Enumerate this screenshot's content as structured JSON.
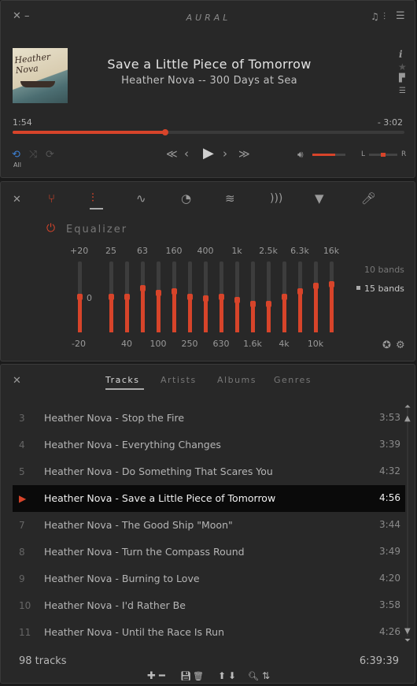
{
  "app": {
    "title": "AURAL"
  },
  "player": {
    "track_title": "Save a Little Piece of Tomorrow",
    "track_subtitle": "Heather Nova -- 300 Days at Sea",
    "album_art_text": "Heather Nova",
    "time_elapsed": "1:54",
    "time_remaining": "- 3:02",
    "progress": 0.39,
    "volume": 0.7,
    "balance": 0.5,
    "repeat_label": "All",
    "balance_left": "L",
    "balance_right": "R",
    "icons": {
      "close": "close-icon",
      "minimize": "minimize-icon",
      "playlist": "playlist-icon",
      "equalizer": "equalizer-toggle-icon",
      "menu": "menu-icon",
      "info": "info-icon",
      "star": "star-icon",
      "bookmark": "bookmark-icon",
      "lyrics": "lyrics-icon",
      "repeat": "repeat-icon",
      "shuffle": "shuffle-icon",
      "loop": "loop-icon",
      "rewind": "rewind-icon",
      "previous": "previous-icon",
      "play": "play-icon",
      "next": "next-icon",
      "fast_forward": "fast-forward-icon",
      "volume": "volume-icon"
    }
  },
  "effects": {
    "section_title": "Equalizer",
    "tabs": [
      "master",
      "equalizer",
      "pitch",
      "time",
      "reverb",
      "delay",
      "filter",
      "recorder"
    ],
    "active_tab": "equalizer",
    "gain_labels": {
      "max": "+20",
      "zero": "0",
      "min": "-20"
    },
    "bands_options": [
      "10 bands",
      "15 bands"
    ],
    "selected_bands": "15 bands",
    "bands": [
      {
        "freq": "25",
        "label_pos": "top",
        "value": 0
      },
      {
        "freq": "40",
        "label_pos": "bottom",
        "value": 0
      },
      {
        "freq": "63",
        "label_pos": "top",
        "value": 5
      },
      {
        "freq": "100",
        "label_pos": "bottom",
        "value": 2
      },
      {
        "freq": "160",
        "label_pos": "top",
        "value": 3
      },
      {
        "freq": "250",
        "label_pos": "bottom",
        "value": 0
      },
      {
        "freq": "400",
        "label_pos": "top",
        "value": -1
      },
      {
        "freq": "630",
        "label_pos": "bottom",
        "value": 0
      },
      {
        "freq": "1k",
        "label_pos": "top",
        "value": -2
      },
      {
        "freq": "1.6k",
        "label_pos": "bottom",
        "value": -4
      },
      {
        "freq": "2.5k",
        "label_pos": "top",
        "value": -4
      },
      {
        "freq": "4k",
        "label_pos": "bottom",
        "value": 0
      },
      {
        "freq": "6.3k",
        "label_pos": "top",
        "value": 3
      },
      {
        "freq": "10k",
        "label_pos": "bottom",
        "value": 6
      },
      {
        "freq": "16k",
        "label_pos": "top",
        "value": 7
      }
    ],
    "master_gain": 0,
    "colors": {
      "accent": "#d7442a",
      "track": "#3d3d3d"
    }
  },
  "playlist": {
    "tabs": [
      "Tracks",
      "Artists",
      "Albums",
      "Genres"
    ],
    "active_tab": "Tracks",
    "tracks": [
      {
        "num": "3",
        "name": "Heather Nova - Stop the Fire",
        "duration": "3:53",
        "playing": false
      },
      {
        "num": "4",
        "name": "Heather Nova - Everything Changes",
        "duration": "3:39",
        "playing": false
      },
      {
        "num": "5",
        "name": "Heather Nova - Do Something That Scares You",
        "duration": "4:32",
        "playing": false
      },
      {
        "num": "",
        "name": "Heather Nova - Save a Little Piece of Tomorrow",
        "duration": "4:56",
        "playing": true
      },
      {
        "num": "7",
        "name": "Heather Nova - The Good Ship \"Moon\"",
        "duration": "3:44",
        "playing": false
      },
      {
        "num": "8",
        "name": "Heather Nova - Turn the Compass Round",
        "duration": "3:49",
        "playing": false
      },
      {
        "num": "9",
        "name": "Heather Nova - Burning to Love",
        "duration": "4:20",
        "playing": false
      },
      {
        "num": "10",
        "name": "Heather Nova - I'd Rather Be",
        "duration": "3:58",
        "playing": false
      },
      {
        "num": "11",
        "name": "Heather Nova - Until the Race Is Run",
        "duration": "4:26",
        "playing": false
      }
    ],
    "track_count": "98 tracks",
    "total_time": "6:39:39",
    "toolbar_icons": [
      "add-icon",
      "remove-icon",
      "save-icon",
      "delete-icon",
      "move-up-icon",
      "move-down-icon",
      "search-icon",
      "sort-icon"
    ]
  }
}
